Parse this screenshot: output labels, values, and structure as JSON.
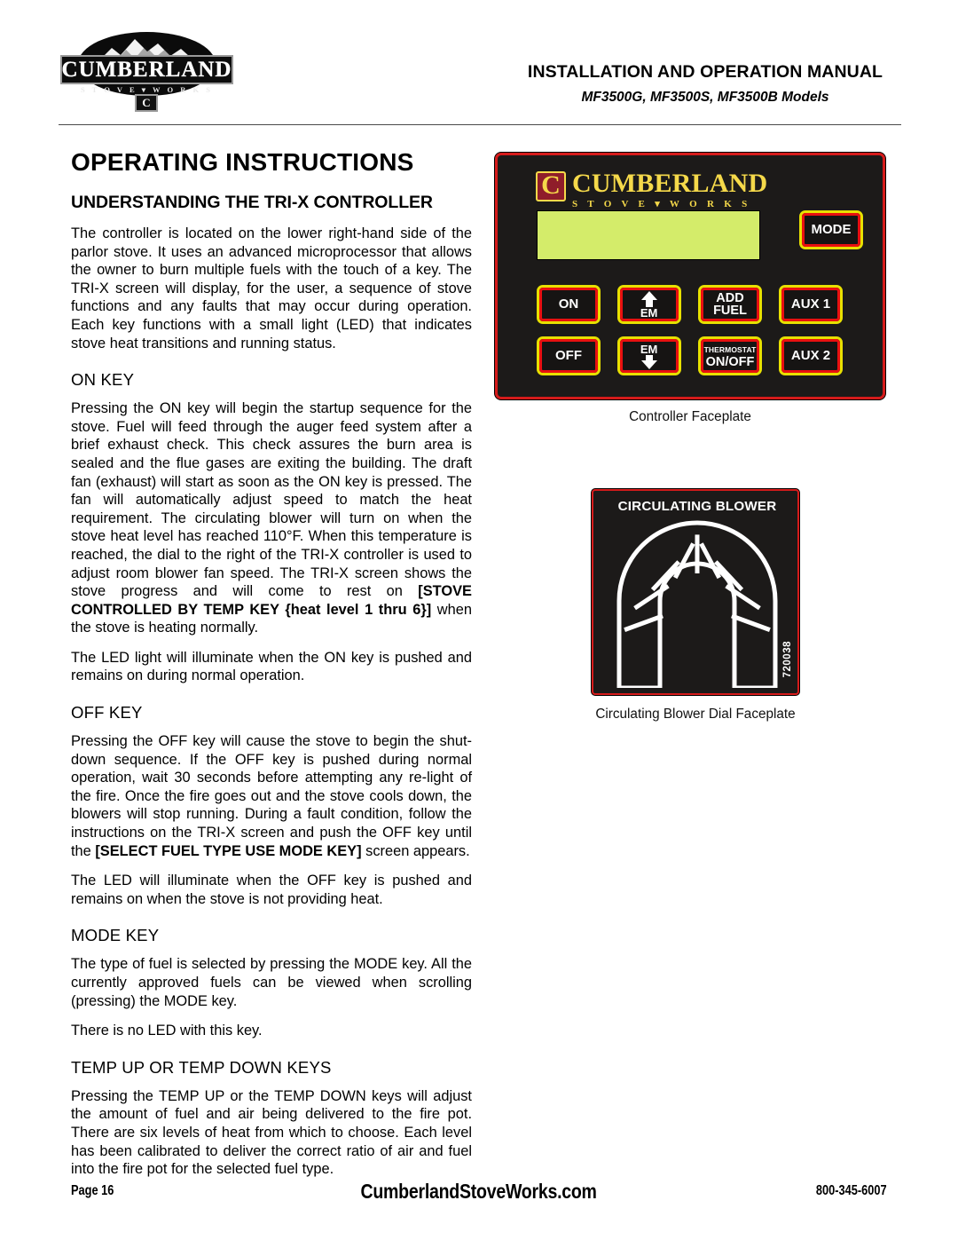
{
  "header": {
    "logo": {
      "wordmark": "CUMBERLAND",
      "tagline": "S T O V E  ▾  W O R K S",
      "badge_letter": "C"
    },
    "title": "INSTALLATION AND OPERATION MANUAL",
    "subtitle": "MF3500G, MF3500S, MF3500B Models"
  },
  "left": {
    "page_title": "OPERATING INSTRUCTIONS",
    "section_title": "UNDERSTANDING THE TRI-X CONTROLLER",
    "intro": "The controller is located on the lower right-hand side of the parlor stove.  It uses an advanced microprocessor that allows the owner to burn multiple fuels with the touch of a key. The TRI-X screen will display, for the user, a sequence of stove functions and any faults that may occur during operation.  Each key functions with a small light (LED) that indicates stove heat transitions and running status.",
    "on_key_heading": "ON KEY",
    "on_key_p1_a": "Pressing the ON key will begin the startup sequence for the stove.  Fuel will feed through the auger feed system after a brief exhaust check.  This check assures the burn area is sealed and the flue gases are exiting the building. The draft fan (exhaust) will start as soon as the ON key is pressed. The fan will automatically adjust speed to match the heat requirement.  The circulating blower will turn on when the stove heat level has reached 110°F.  When this temperature is reached, the dial to the right of the TRI-X controller is used to adjust room blower fan speed.  The TRI-X screen shows the stove progress and will come to rest on ",
    "on_key_p1_bold": "[STOVE CONTROLLED BY TEMP KEY {heat level 1 thru 6}]",
    "on_key_p1_c": " when the stove is heating normally.",
    "on_key_p2": "The LED light will illuminate when the ON key is pushed and remains on during normal operation.",
    "off_key_heading": "OFF KEY",
    "off_key_p1_a": "Pressing the OFF key will cause the stove to begin the shut-down sequence.  If the OFF key is pushed during normal operation, wait 30 seconds before attempting any re-light of the fire.  Once the fire goes out and the stove cools down, the blowers will stop running.  During a fault condition, follow the instructions on the TRI-X screen and push the OFF key until the ",
    "off_key_p1_bold": "[SELECT FUEL TYPE USE MODE KEY]",
    "off_key_p1_c": " screen appears.",
    "off_key_p2": "The LED will illuminate when the OFF key is pushed and remains on when the stove is not providing heat.",
    "mode_key_heading": "MODE KEY",
    "mode_key_p1": "The type of fuel is selected by pressing the MODE key.  All the currently approved fuels can be viewed when scrolling (pressing) the MODE key.",
    "mode_key_p2": "There is no LED with this key.",
    "temp_keys_heading": "TEMP UP OR TEMP DOWN KEYS",
    "temp_keys_p1": "Pressing the TEMP UP or the TEMP DOWN keys will adjust the amount of fuel and air being delivered to the fire pot.  There are six levels of heat from which to choose.  Each level has been calibrated to deliver the correct ratio of air and fuel into the fire pot for the selected fuel type."
  },
  "controller": {
    "brand_word": "CUMBERLAND",
    "brand_tagline": "S T O V E ▾ W O R K S",
    "brand_badge": "C",
    "keys": {
      "mode": "MODE",
      "on": "ON",
      "temp_up": "TEMP",
      "add_fuel_line1": "ADD",
      "add_fuel_line2": "FUEL",
      "aux1": "AUX 1",
      "off": "OFF",
      "temp_down": "TEMP",
      "thermostat_line1": "THERMOSTAT",
      "thermostat_line2": "ON/OFF",
      "aux2": "AUX 2"
    },
    "caption": "Controller Faceplate",
    "colors": {
      "body": "#1c1a19",
      "outer_border": "#d61b1b",
      "key_outer": "#e8e000",
      "key_inner": "#e81010",
      "lcd": "#d4ec6a",
      "brand_yellow": "#f5d94a",
      "badge_red": "#8f1d2a"
    }
  },
  "blower": {
    "title": "CIRCULATING BLOWER",
    "part_number": "720038",
    "caption": "Circulating Blower Dial Faceplate"
  },
  "footer": {
    "page": "Page 16",
    "site": "CumberlandStoveWorks.com",
    "phone": "800-345-6007"
  }
}
